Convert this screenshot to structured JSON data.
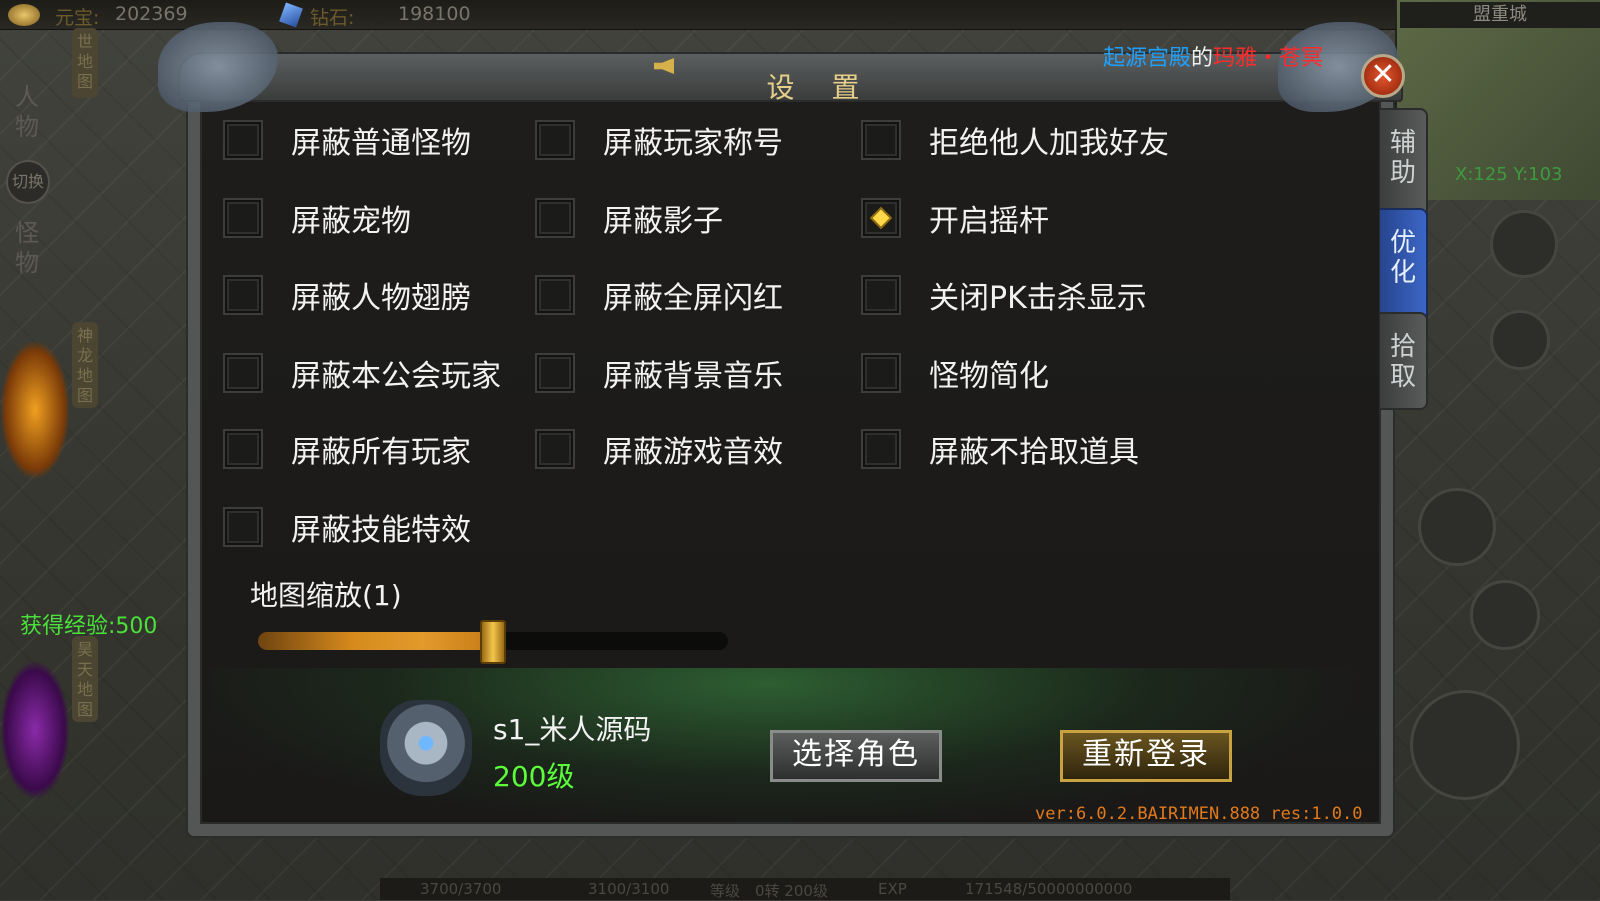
{
  "topbar": {
    "yuanbao_label": "元宝:",
    "yuanbao_value": "202369",
    "diamond_label": "钻石:",
    "diamond_value": "198100"
  },
  "minimap": {
    "title": "盟重城",
    "coords": "X:125 Y:103"
  },
  "left_panel": {
    "tab1": "人物",
    "swap": "切换",
    "tab2": "怪物",
    "map1": "世地图",
    "map2": "神龙地图",
    "map3": "昊天地图"
  },
  "exp_gain": "获得经验:500",
  "statusbar": {
    "hp": "3700/3700",
    "mp": "3100/3100",
    "level_label": "等级",
    "level": "0转 200级",
    "exp_label": "EXP",
    "exp": "171548/50000000000"
  },
  "dialog": {
    "title": "设 置",
    "location": {
      "place": "起源宫殿",
      "particle": "的",
      "npc": "玛雅・苍冥"
    },
    "close_glyph": "✕",
    "options": [
      {
        "label": "屏蔽普通怪物",
        "checked": false
      },
      {
        "label": "屏蔽玩家称号",
        "checked": false
      },
      {
        "label": "拒绝他人加我好友",
        "checked": false
      },
      {
        "label": "屏蔽宠物",
        "checked": false
      },
      {
        "label": "屏蔽影子",
        "checked": false
      },
      {
        "label": "开启摇杆",
        "checked": true
      },
      {
        "label": "屏蔽人物翅膀",
        "checked": false
      },
      {
        "label": "屏蔽全屏闪红",
        "checked": false
      },
      {
        "label": "关闭PK击杀显示",
        "checked": false
      },
      {
        "label": "屏蔽本公会玩家",
        "checked": false
      },
      {
        "label": "屏蔽背景音乐",
        "checked": false
      },
      {
        "label": "怪物简化",
        "checked": false
      },
      {
        "label": "屏蔽所有玩家",
        "checked": false
      },
      {
        "label": "屏蔽游戏音效",
        "checked": false
      },
      {
        "label": "屏蔽不拾取道具",
        "checked": false
      },
      {
        "label": "屏蔽技能特效",
        "checked": false
      }
    ],
    "zoom": {
      "label": "地图缩放(1)",
      "fraction": 0.5
    },
    "player": {
      "name": "s1_米人源码",
      "level": "200级"
    },
    "buttons": {
      "select_role": "选择角色",
      "relogin": "重新登录"
    },
    "version": "ver:6.0.2.BAIRIMEN.888 res:1.0.0",
    "side_tabs": [
      "辅助",
      "优化",
      "拾取"
    ],
    "active_side_tab": 1
  },
  "colors": {
    "accent_blue": "#1ea0ff",
    "npc_red": "#ff2a2a",
    "exp_green": "#49e23a",
    "checked_gold": "#ffd84a"
  }
}
